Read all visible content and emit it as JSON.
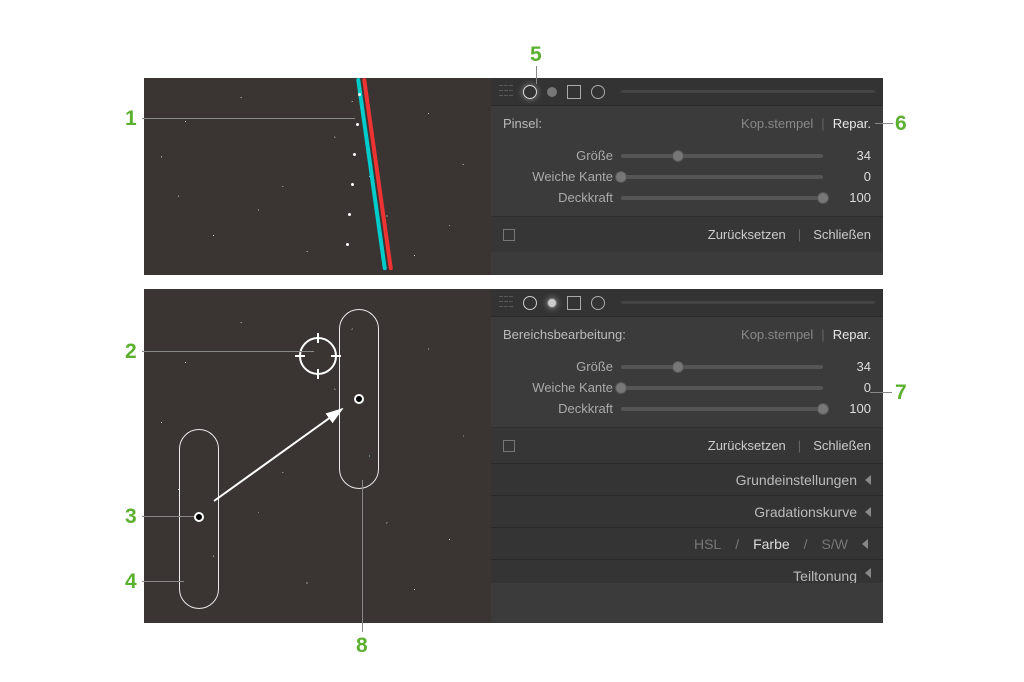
{
  "callouts": {
    "c1": "1",
    "c2": "2",
    "c3": "3",
    "c4": "4",
    "c5": "5",
    "c6": "6",
    "c7": "7",
    "c8": "8"
  },
  "panel_top": {
    "mode_label": "Pinsel:",
    "mode_option_a": "Kop.stempel",
    "mode_option_b": "Repar.",
    "sliders": {
      "size_label": "Größe",
      "size_value": "34",
      "feather_label": "Weiche Kante",
      "feather_value": "0",
      "opacity_label": "Deckkraft",
      "opacity_value": "100"
    },
    "reset": "Zurücksetzen",
    "close": "Schließen"
  },
  "panel_bottom": {
    "mode_label": "Bereichsbearbeitung:",
    "mode_option_a": "Kop.stempel",
    "mode_option_b": "Repar.",
    "sliders": {
      "size_label": "Größe",
      "size_value": "34",
      "feather_label": "Weiche Kante",
      "feather_value": "0",
      "opacity_label": "Deckkraft",
      "opacity_value": "100"
    },
    "reset": "Zurücksetzen",
    "close": "Schließen",
    "accordion": {
      "basic": "Grundeinstellungen",
      "curve": "Gradationskurve",
      "hsl_hsl": "HSL",
      "hsl_color": "Farbe",
      "hsl_bw": "S/W",
      "split": "Teiltonung"
    }
  }
}
